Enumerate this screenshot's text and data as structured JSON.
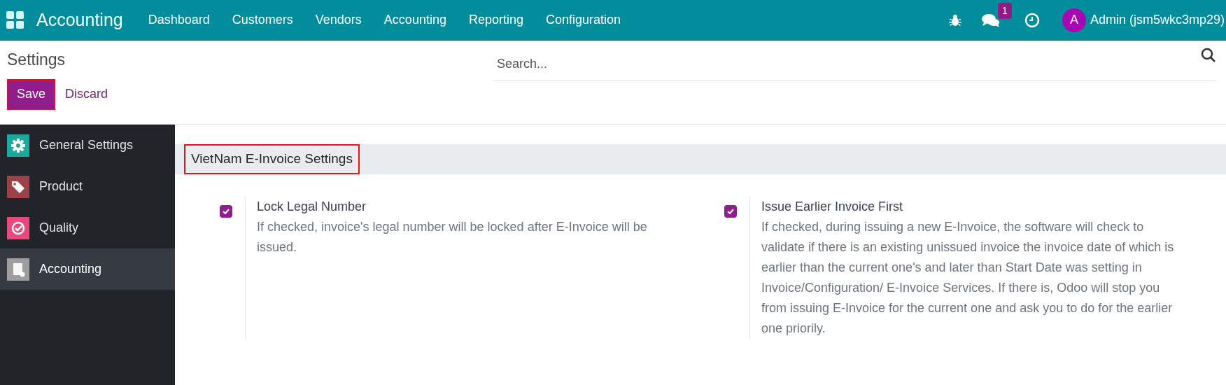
{
  "navbar": {
    "app_name": "Accounting",
    "menu": [
      "Dashboard",
      "Customers",
      "Vendors",
      "Accounting",
      "Reporting",
      "Configuration"
    ],
    "messages_badge": "1",
    "user": {
      "avatar_letter": "A",
      "name": "Admin (jsm5wkc3mp29)"
    }
  },
  "control_panel": {
    "title": "Settings",
    "search": {
      "placeholder": "Search..."
    },
    "save": {
      "label": "Save",
      "highlighted": true
    },
    "discard": {
      "label": "Discard"
    }
  },
  "sidebar": {
    "items": [
      {
        "label": "General Settings",
        "kind": "gear",
        "color": "#1aa99a",
        "selected": false
      },
      {
        "label": "Product",
        "kind": "tag",
        "color": "#9c4149",
        "selected": false
      },
      {
        "label": "Quality",
        "kind": "quality",
        "color": "#e9497a",
        "selected": false
      },
      {
        "label": "Accounting",
        "kind": "accounting",
        "color": "#9e9e9e",
        "selected": true
      }
    ]
  },
  "section": {
    "title": "VietNam E-Invoice Settings",
    "highlighted": true,
    "settings": [
      {
        "label": "Lock Legal Number",
        "checked": true,
        "description": "If checked, invoice's legal number will be locked after E-Invoice will be issued."
      },
      {
        "label": "Issue Earlier Invoice First",
        "checked": true,
        "description": "If checked, during issuing a new E-Invoice, the software will check to validate if there is an existing unissued invoice the invoice date of which is earlier than the current one's and later than Start Date was setting in Invoice/Configuration/ E-Invoice Services. If there is, Odoo will stop you from issuing E-Invoice for the current one and ask you to do for the earlier one priorily."
      }
    ]
  }
}
